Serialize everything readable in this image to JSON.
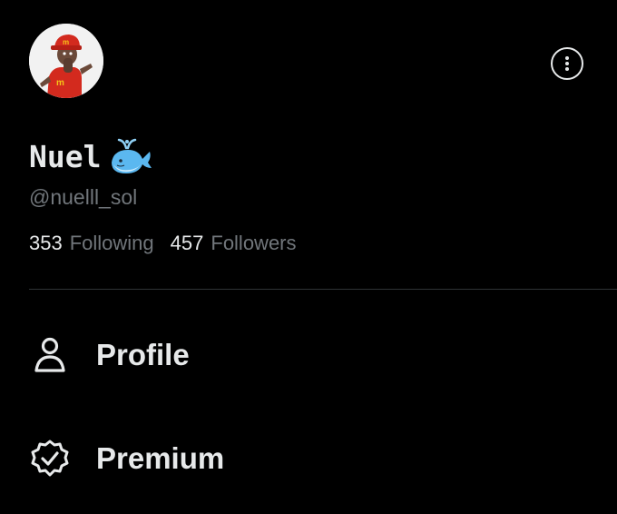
{
  "profile": {
    "display_name": "Nuel",
    "name_emoji_icon": "whale-emoji-icon",
    "handle": "@nuelll_sol",
    "following_count": "353",
    "following_label": "Following",
    "followers_count": "457",
    "followers_label": "Followers",
    "more_icon": "more-options-icon"
  },
  "menu": {
    "items": [
      {
        "label": "Profile",
        "icon": "person-icon"
      },
      {
        "label": "Premium",
        "icon": "verified-badge-icon"
      }
    ]
  },
  "colors": {
    "background": "#000000",
    "primary_text": "#e7e9ea",
    "secondary_text": "#71767b",
    "divider": "#2f3336"
  }
}
